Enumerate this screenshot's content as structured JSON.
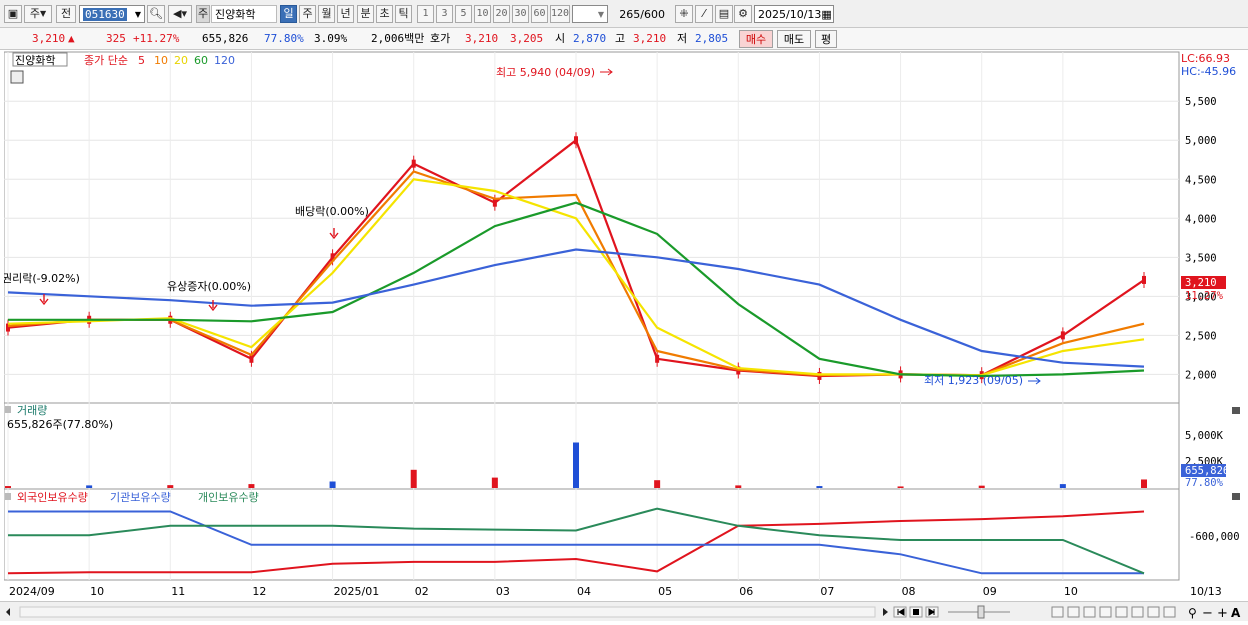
{
  "toolbar": {
    "market_type": "주",
    "prev_label": "전",
    "stock_code": "051630",
    "stock_badge": "주",
    "stock_name": "진양화학",
    "periods": [
      "일",
      "주",
      "월",
      "년",
      "분",
      "초",
      "틱"
    ],
    "minutes": [
      "1",
      "3",
      "5",
      "10",
      "20",
      "30",
      "60",
      "120"
    ],
    "count_value": "265",
    "count_total": "/600",
    "date": "2025/10/13"
  },
  "quote": {
    "price": "3,210",
    "change": "325",
    "change_pct": "+11.27%",
    "volume": "655,826",
    "vol_ratio": "77.80%",
    "turnover_pct": "3.09%",
    "amount": "2,006백만",
    "bid_label": "호가",
    "ask": "3,210",
    "bid": "3,205",
    "open_label": "시",
    "open": "2,870",
    "high_label": "고",
    "high": "3,210",
    "low_label": "저",
    "low": "2,805",
    "buy_label": "매수",
    "sell_label": "매도",
    "eval_label": "평"
  },
  "colors": {
    "up": "#e0141e",
    "down": "#1f4fd6",
    "ma5": "#e0141e",
    "ma10": "#f07b00",
    "ma20": "#f5e400",
    "ma60": "#1a9a2a",
    "ma120": "#3a62d8",
    "inst": "#2a8a5a"
  },
  "legend": {
    "name": "진양화학",
    "title": "종가 단순",
    "ma": [
      "5",
      "10",
      "20",
      "60",
      "120"
    ]
  },
  "price_panel": {
    "lc": "LC:66.93",
    "hc": "HC:-45.96",
    "current": "3,210",
    "current_pct": "11.27%",
    "y_ticks": [
      "5,500",
      "5,000",
      "4,500",
      "4,000",
      "3,500",
      "3,000",
      "2,500",
      "2,000"
    ],
    "high_annot": "최고 5,940 (04/09)",
    "low_annot": "최저 1,923 (09/05)",
    "events": [
      "권리락(-9.02%)",
      "유상증자(0.00%)",
      "배당락(0.00%)"
    ]
  },
  "volume_panel": {
    "title": "거래량",
    "value": "655,826주(77.80%)",
    "y_ticks": [
      "5,000K",
      "2,500K"
    ],
    "current": "655,826",
    "current_pct": "77.80%"
  },
  "holding_panel": {
    "series": [
      "외국인보유수량",
      "기관보유수량",
      "개인보유수량"
    ],
    "y_tick": "-600,000"
  },
  "x_axis": [
    "2024/09",
    "10",
    "11",
    "12",
    "2025/01",
    "02",
    "03",
    "04",
    "05",
    "06",
    "07",
    "08",
    "09",
    "10",
    "10/13"
  ],
  "chart_data": {
    "type": "line",
    "x": [
      "2024/09",
      "2024/10",
      "2024/11",
      "2024/12",
      "2025/01",
      "2025/02",
      "2025/03",
      "2025/04",
      "2025/05",
      "2025/06",
      "2025/07",
      "2025/08",
      "2025/09",
      "2025/10",
      "10/13"
    ],
    "series": [
      {
        "name": "5",
        "values": [
          2600,
          2700,
          2700,
          2200,
          3500,
          4700,
          4200,
          5000,
          2200,
          2050,
          1980,
          2000,
          1990,
          2500,
          3210
        ]
      },
      {
        "name": "10",
        "values": [
          2620,
          2700,
          2700,
          2250,
          3450,
          4600,
          4250,
          4300,
          2300,
          2060,
          1990,
          2000,
          1990,
          2400,
          2650
        ]
      },
      {
        "name": "20",
        "values": [
          2650,
          2680,
          2720,
          2350,
          3300,
          4500,
          4350,
          4000,
          2600,
          2080,
          2000,
          2000,
          1990,
          2300,
          2450
        ]
      },
      {
        "name": "60",
        "values": [
          2700,
          2700,
          2700,
          2680,
          2800,
          3300,
          3900,
          4200,
          3800,
          2900,
          2200,
          2000,
          1980,
          2000,
          2050
        ]
      },
      {
        "name": "120",
        "values": [
          3050,
          3000,
          2950,
          2880,
          2920,
          3150,
          3400,
          3600,
          3500,
          3350,
          3150,
          2700,
          2300,
          2150,
          2100
        ]
      }
    ],
    "ylim": [
      1800,
      5900
    ],
    "volume": [
      150,
      200,
      220,
      300,
      500,
      1400,
      800,
      3500,
      600,
      200,
      150,
      120,
      180,
      300,
      655.826
    ],
    "volume_unit": "K",
    "holdings": [
      {
        "name": "외국인보유수량",
        "values": [
          -800,
          -790,
          -790,
          -790,
          -700,
          -680,
          -680,
          -650,
          -780,
          -300,
          -280,
          -250,
          -230,
          -200,
          -150
        ]
      },
      {
        "name": "기관보유수량",
        "values": [
          -150,
          -150,
          -150,
          -500,
          -500,
          -500,
          -500,
          -500,
          -500,
          -500,
          -500,
          -600,
          -800,
          -800,
          -800
        ]
      },
      {
        "name": "개인보유수량",
        "values": [
          -400,
          -400,
          -300,
          -300,
          -300,
          -330,
          -340,
          -350,
          -120,
          -300,
          -400,
          -450,
          -450,
          -450,
          -800
        ]
      }
    ],
    "holdings_ylim": [
      -850,
      -50
    ]
  }
}
